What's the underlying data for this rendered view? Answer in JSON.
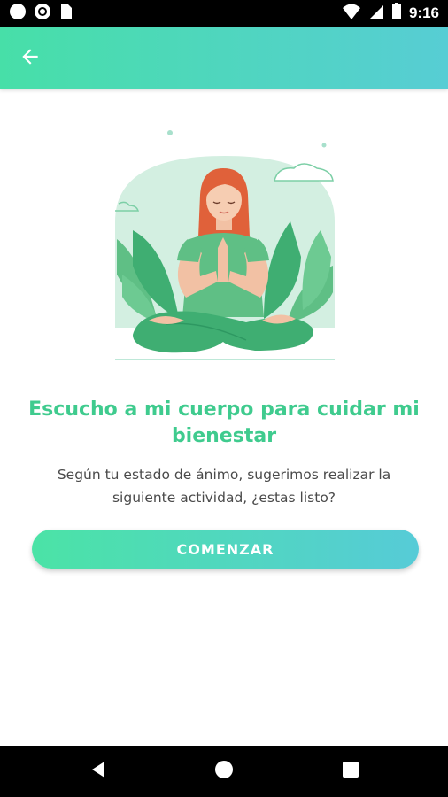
{
  "status_bar": {
    "time": "9:16",
    "left_icons": [
      "circle-icon",
      "record-icon",
      "sim-card-icon"
    ],
    "right_icons": [
      "wifi-icon",
      "signal-icon",
      "battery-icon"
    ]
  },
  "app_bar": {
    "back_icon": "arrow-left-icon",
    "gradient": [
      "#47dfa8",
      "#57cdd4"
    ]
  },
  "main": {
    "title": "Escucho a mi cuerpo para cuidar mi bienestar",
    "description": "Según tu estado de ánimo, sugerimos realizar la siguiente actividad, ¿estas listo?",
    "button_label": "COMENZAR"
  },
  "nav_bar": {
    "icons": [
      "back-triangle-icon",
      "home-circle-icon",
      "recents-square-icon"
    ]
  },
  "colors": {
    "accent": "#3fcb8e",
    "text": "#4a4a4a"
  }
}
